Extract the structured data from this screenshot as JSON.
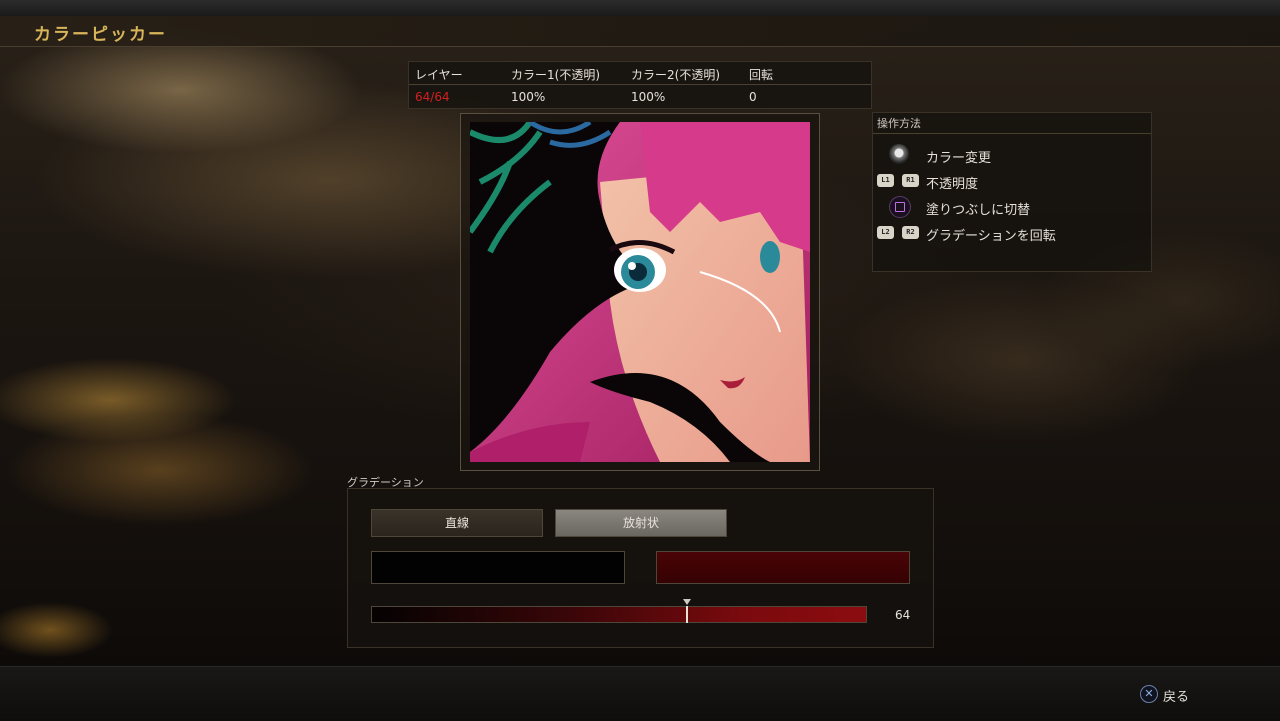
{
  "screen": {
    "title": "カラーピッカー"
  },
  "info": {
    "headers": [
      "レイヤー",
      "カラー1(不透明)",
      "カラー2(不透明)",
      "回転"
    ],
    "values": [
      "64/64",
      "100%",
      "100%",
      "0"
    ]
  },
  "controls": {
    "title": "操作方法",
    "items": [
      {
        "icon": "left-stick-icon",
        "label": "カラー変更"
      },
      {
        "icon": "l1-r1-icon",
        "buttons": [
          "L1",
          "R1"
        ],
        "label": "不透明度"
      },
      {
        "icon": "square-button-icon",
        "label": "塗りつぶしに切替"
      },
      {
        "icon": "l2-r2-icon",
        "buttons": [
          "L2",
          "R2"
        ],
        "label": "グラデーションを回転"
      }
    ]
  },
  "gradation": {
    "title": "グラデーション",
    "linear_label": "直線",
    "radial_label": "放射状",
    "selected": "radial",
    "color1": "#030202",
    "color2": "#4a0406",
    "slider_value": "64",
    "slider_fraction": 0.64
  },
  "footer": {
    "back_label": "戻る",
    "button_icon": "cross-button-icon"
  },
  "colors": {
    "title": "#d8b45a",
    "layer_count": "#d02020"
  }
}
